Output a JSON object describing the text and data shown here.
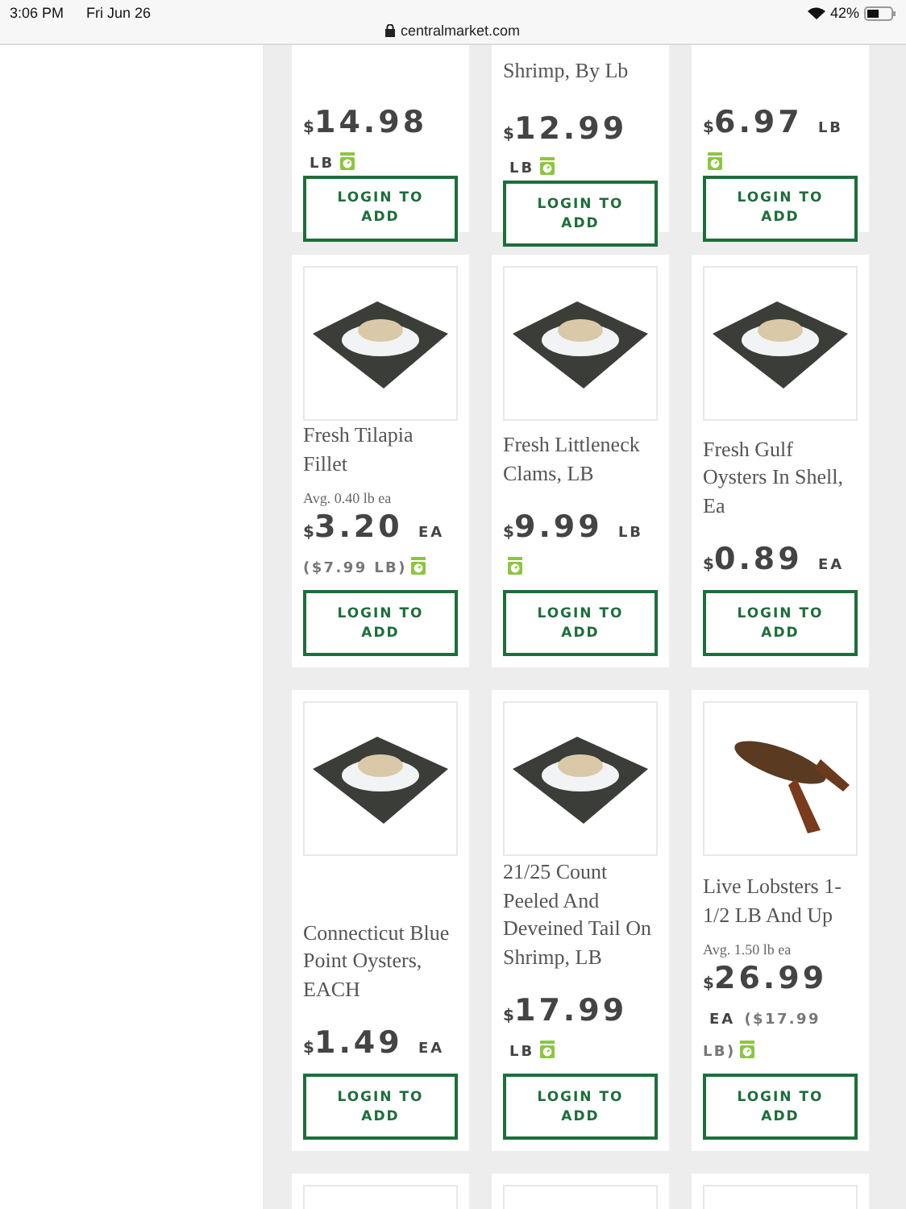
{
  "status_bar": {
    "time": "3:06 PM",
    "date": "Fri Jun 26",
    "url": "centralmarket.com",
    "battery": "42%"
  },
  "rows": [
    {
      "kind": "cut",
      "items": [
        {
          "price": {
            "currency": "$",
            "amount": "14.98",
            "unit": "LB",
            "scale": true
          },
          "button": "LOGIN TO ADD"
        },
        {
          "name": "Shrimp, By Lb",
          "price": {
            "currency": "$",
            "amount": "12.99",
            "unit": "LB",
            "scale": true
          },
          "button": "LOGIN TO ADD"
        },
        {
          "price": {
            "currency": "$",
            "amount": "6.97",
            "unit": "LB",
            "scale": true
          },
          "button": "LOGIN TO ADD"
        }
      ]
    },
    {
      "kind": "full",
      "items": [
        {
          "kind": "platter",
          "name": "Fresh Tilapia Fillet",
          "avg": "Avg. 0.40 lb ea",
          "price": {
            "currency": "$",
            "amount": "3.20",
            "unit": "EA",
            "per_lb": "($7.99 LB)",
            "scale": true
          },
          "button": "LOGIN TO ADD"
        },
        {
          "kind": "platter",
          "name": "Fresh Littleneck Clams, LB",
          "price": {
            "currency": "$",
            "amount": "9.99",
            "unit": "LB",
            "scale": true
          },
          "button": "LOGIN TO ADD"
        },
        {
          "kind": "platter",
          "name": "Fresh Gulf Oysters In Shell, Ea",
          "price": {
            "currency": "$",
            "amount": "0.89",
            "unit": "EA",
            "scale": false
          },
          "button": "LOGIN TO ADD"
        }
      ]
    },
    {
      "kind": "full",
      "items": [
        {
          "kind": "platter",
          "name": "Connecticut Blue Point Oysters, EACH",
          "price": {
            "currency": "$",
            "amount": "1.49",
            "unit": "EA",
            "scale": false
          },
          "button": "LOGIN TO ADD"
        },
        {
          "kind": "platter",
          "name": "21/25 Count Peeled And Deveined Tail On Shrimp, LB",
          "price": {
            "currency": "$",
            "amount": "17.99",
            "unit": "LB",
            "scale": true
          },
          "button": "LOGIN TO ADD"
        },
        {
          "kind": "lobster",
          "name": "Live Lobsters 1-1/2 LB And Up",
          "avg": "Avg. 1.50 lb ea",
          "price": {
            "currency": "$",
            "amount": "26.99",
            "unit": "EA",
            "per_lb": "($17.99 LB)",
            "scale": true
          },
          "button": "LOGIN TO ADD"
        }
      ]
    },
    {
      "kind": "top",
      "items": [
        {
          "kind": "platter"
        },
        {
          "kind": "platter"
        },
        {
          "kind": "platter"
        }
      ]
    }
  ]
}
